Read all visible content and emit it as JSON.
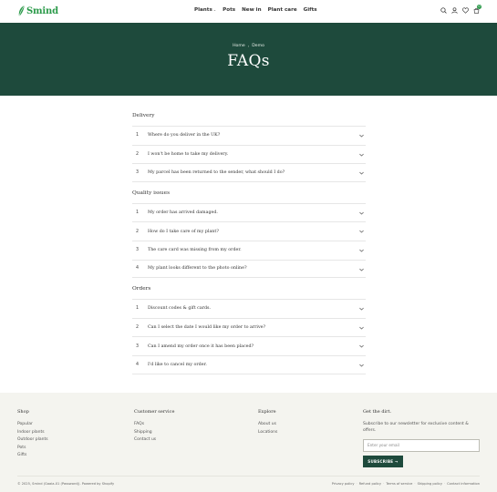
{
  "brand": {
    "name": "Smind",
    "color": "#2b9a4a"
  },
  "nav": {
    "items": [
      {
        "label": "Plants",
        "has_dropdown": true
      },
      {
        "label": "Pots",
        "has_dropdown": false
      },
      {
        "label": "New in",
        "has_dropdown": false
      },
      {
        "label": "Plant care",
        "has_dropdown": false
      },
      {
        "label": "Gifts",
        "has_dropdown": false
      }
    ],
    "icons": [
      "search-icon",
      "account-icon",
      "wishlist-icon",
      "cart-icon"
    ],
    "cart_count": "0"
  },
  "hero": {
    "breadcrumb": [
      "Home",
      "Demo"
    ],
    "title": "FAQs",
    "background": "#1e4a3c"
  },
  "faq": {
    "sections": [
      {
        "title": "Delivery",
        "items": [
          {
            "num": "1",
            "q": "Where do you deliver in the UK?"
          },
          {
            "num": "2",
            "q": "I won't be home to take my delivery."
          },
          {
            "num": "3",
            "q": "My parcel has been returned to the sender, what should I do?"
          }
        ]
      },
      {
        "title": "Quality issues",
        "items": [
          {
            "num": "1",
            "q": "My order has arrived damaged."
          },
          {
            "num": "2",
            "q": "How do I take care of my plant?"
          },
          {
            "num": "3",
            "q": "The care card was missing from my order."
          },
          {
            "num": "4",
            "q": "My plant looks different to the photo online?"
          }
        ]
      },
      {
        "title": "Orders",
        "items": [
          {
            "num": "1",
            "q": "Discount codes & gift cards."
          },
          {
            "num": "2",
            "q": "Can I select the date I would like my order to arrive?"
          },
          {
            "num": "3",
            "q": "Can I amend my order once it has been placed?"
          },
          {
            "num": "4",
            "q": "I'd like to cancel my order."
          }
        ]
      }
    ]
  },
  "footer": {
    "shop": {
      "title": "Shop",
      "links": [
        "Popular",
        "Indoor plants",
        "Outdoor plants",
        "Pots",
        "Gifts"
      ]
    },
    "customer_service": {
      "title": "Customer service",
      "links": [
        "FAQs",
        "Shipping",
        "Contact us"
      ]
    },
    "explore": {
      "title": "Explore",
      "links": [
        "About us",
        "Locations"
      ]
    },
    "newsletter": {
      "title": "Get the dirt.",
      "description": "Subscribe to our newsletter for exclusive content & offers.",
      "placeholder": "Enter your email",
      "button": "SUBSCRIBE →"
    },
    "copyright": "© 2025, Smind (Gaaia-01 (Password)). Powered by Shopify",
    "legal": [
      "Privacy policy",
      "Refund policy",
      "Terms of service",
      "Shipping policy",
      "Contact information"
    ]
  }
}
